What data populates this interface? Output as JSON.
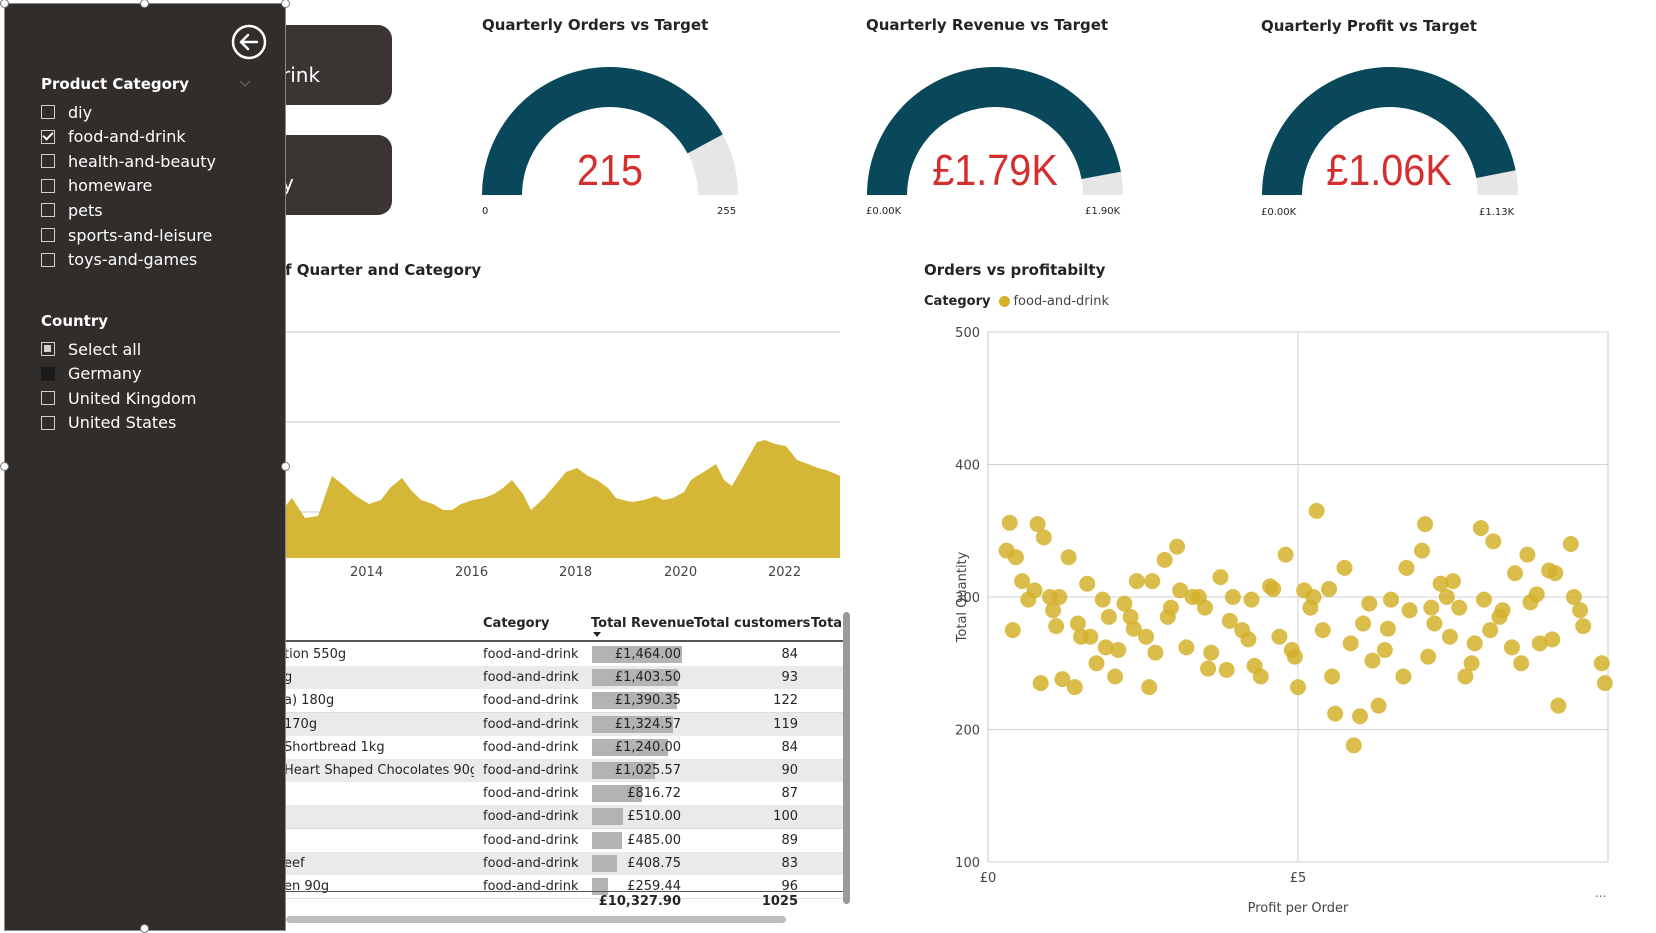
{
  "nav_buttons": [
    {
      "label": "rink"
    },
    {
      "label": "y"
    }
  ],
  "gauges": [
    {
      "title": "Quarterly Orders vs Target",
      "value_label": "215",
      "fraction": 0.843,
      "min_label": "0",
      "max_label": "255"
    },
    {
      "title": "Quarterly Revenue vs Target",
      "value_label": "£1.79K",
      "fraction": 0.942,
      "min_label": "£0.00K",
      "max_label": "£1.90K"
    },
    {
      "title": "Quarterly Profit vs Target",
      "value_label": "£1.06K",
      "fraction": 0.938,
      "min_label": "£0.00K",
      "max_label": "£1.13K"
    }
  ],
  "colors": {
    "gauge_fill": "#08485a",
    "gauge_track": "#e6e6e6",
    "value_red": "#d32f2f",
    "accent_gold": "#d4b22c",
    "panel_bg": "#302d2b"
  },
  "area_chart": {
    "title": "f Quarter and Category",
    "x_ticks": [
      "2014",
      "2016",
      "2018",
      "2020",
      "2022"
    ]
  },
  "chart_data": {
    "type": "scatter",
    "title": "Orders vs profitabilty",
    "legend_title": "Category",
    "series": [
      {
        "name": "food-and-drink",
        "color": "#d4b22c"
      }
    ],
    "xlabel": "Profit per Order",
    "ylabel": "Total Quantity",
    "x_tick_labels": [
      "£0",
      "£5"
    ],
    "y_tick_labels": [
      "100",
      "200",
      "300",
      "400",
      "500"
    ],
    "xlim": [
      0,
      10
    ],
    "ylim": [
      100,
      500
    ],
    "grid": true,
    "points": [
      [
        0.4,
        275
      ],
      [
        0.85,
        235
      ],
      [
        1.1,
        278
      ],
      [
        1.4,
        232
      ],
      [
        1.65,
        270
      ],
      [
        1.9,
        262
      ],
      [
        2.2,
        295
      ],
      [
        2.55,
        270
      ],
      [
        2.85,
        328
      ],
      [
        3.1,
        305
      ],
      [
        3.5,
        292
      ],
      [
        3.85,
        245
      ],
      [
        4.2,
        268
      ],
      [
        4.55,
        308
      ],
      [
        4.95,
        255
      ],
      [
        5.3,
        365
      ],
      [
        5.55,
        240
      ],
      [
        6.0,
        210
      ],
      [
        6.3,
        218
      ],
      [
        7.1,
        255
      ],
      [
        7.2,
        280
      ],
      [
        7.5,
        312
      ],
      [
        7.85,
        265
      ],
      [
        8.1,
        275
      ],
      [
        8.5,
        318
      ],
      [
        8.9,
        265
      ],
      [
        9.2,
        218
      ],
      [
        9.55,
        290
      ],
      [
        9.9,
        250
      ],
      [
        9.95,
        235
      ],
      [
        0.3,
        335
      ],
      [
        0.55,
        312
      ],
      [
        0.8,
        355
      ],
      [
        1.05,
        290
      ],
      [
        1.3,
        330
      ],
      [
        1.6,
        310
      ],
      [
        1.95,
        285
      ],
      [
        2.3,
        285
      ],
      [
        2.6,
        232
      ],
      [
        2.9,
        285
      ],
      [
        3.3,
        300
      ],
      [
        3.6,
        258
      ],
      [
        3.95,
        300
      ],
      [
        4.3,
        248
      ],
      [
        4.7,
        270
      ],
      [
        5.0,
        232
      ],
      [
        5.25,
        300
      ],
      [
        5.6,
        212
      ],
      [
        5.9,
        188
      ],
      [
        6.2,
        252
      ],
      [
        6.5,
        298
      ],
      [
        6.8,
        290
      ],
      [
        7.05,
        355
      ],
      [
        7.4,
        300
      ],
      [
        7.7,
        240
      ],
      [
        8.0,
        298
      ],
      [
        8.3,
        290
      ],
      [
        8.7,
        332
      ],
      [
        9.05,
        320
      ],
      [
        9.4,
        340
      ],
      [
        0.45,
        330
      ],
      [
        0.75,
        305
      ],
      [
        1.0,
        300
      ],
      [
        1.2,
        238
      ],
      [
        1.5,
        270
      ],
      [
        1.85,
        298
      ],
      [
        2.1,
        260
      ],
      [
        2.4,
        312
      ],
      [
        2.7,
        258
      ],
      [
        3.05,
        338
      ],
      [
        3.4,
        300
      ],
      [
        3.75,
        315
      ],
      [
        4.1,
        275
      ],
      [
        4.4,
        240
      ],
      [
        4.8,
        332
      ],
      [
        5.1,
        305
      ],
      [
        5.4,
        275
      ],
      [
        5.75,
        322
      ],
      [
        6.05,
        280
      ],
      [
        6.4,
        260
      ],
      [
        6.7,
        240
      ],
      [
        7.0,
        335
      ],
      [
        7.3,
        310
      ],
      [
        7.6,
        292
      ],
      [
        7.95,
        352
      ],
      [
        8.25,
        285
      ],
      [
        8.6,
        250
      ],
      [
        8.85,
        302
      ],
      [
        9.15,
        318
      ],
      [
        9.6,
        278
      ],
      [
        0.35,
        356
      ],
      [
        0.65,
        298
      ],
      [
        0.9,
        345
      ],
      [
        1.15,
        300
      ],
      [
        1.45,
        280
      ],
      [
        1.75,
        250
      ],
      [
        2.05,
        240
      ],
      [
        2.35,
        276
      ],
      [
        2.65,
        312
      ],
      [
        2.95,
        292
      ],
      [
        3.2,
        262
      ],
      [
        3.55,
        246
      ],
      [
        3.9,
        282
      ],
      [
        4.25,
        298
      ],
      [
        4.6,
        306
      ],
      [
        4.9,
        260
      ],
      [
        5.2,
        292
      ],
      [
        5.5,
        306
      ],
      [
        5.85,
        265
      ],
      [
        6.15,
        295
      ],
      [
        6.45,
        276
      ],
      [
        6.75,
        322
      ],
      [
        7.15,
        292
      ],
      [
        7.45,
        270
      ],
      [
        7.8,
        250
      ],
      [
        8.15,
        342
      ],
      [
        8.45,
        262
      ],
      [
        8.75,
        296
      ],
      [
        9.1,
        268
      ],
      [
        9.45,
        300
      ]
    ]
  },
  "slicers": {
    "product_category": {
      "title": "Product Category",
      "items": [
        {
          "label": "diy",
          "checked": false
        },
        {
          "label": "food-and-drink",
          "checked": true
        },
        {
          "label": "health-and-beauty",
          "checked": false
        },
        {
          "label": "homeware",
          "checked": false
        },
        {
          "label": "pets",
          "checked": false
        },
        {
          "label": "sports-and-leisure",
          "checked": false
        },
        {
          "label": "toys-and-games",
          "checked": false
        }
      ]
    },
    "country": {
      "title": "Country",
      "items": [
        {
          "label": "Select all",
          "state": "partial"
        },
        {
          "label": "Germany",
          "state": "filled"
        },
        {
          "label": "United Kingdom",
          "state": "unchecked"
        },
        {
          "label": "United States",
          "state": "unchecked"
        }
      ]
    }
  },
  "table": {
    "headers": [
      "Category",
      "Total Revenue",
      "Total customers",
      "Tota"
    ],
    "rows": [
      {
        "product": "tion 550g",
        "category": "food-and-drink",
        "revenue": "£1,464.00",
        "revenue_value": 1464.0,
        "customers": "84"
      },
      {
        "product": "g",
        "category": "food-and-drink",
        "revenue": "£1,403.50",
        "revenue_value": 1403.5,
        "customers": "93"
      },
      {
        "product": "a) 180g",
        "category": "food-and-drink",
        "revenue": "£1,390.35",
        "revenue_value": 1390.35,
        "customers": "122"
      },
      {
        "product": "170g",
        "category": "food-and-drink",
        "revenue": "£1,324.57",
        "revenue_value": 1324.57,
        "customers": "119"
      },
      {
        "product": "Shortbread 1kg",
        "category": "food-and-drink",
        "revenue": "£1,240.00",
        "revenue_value": 1240.0,
        "customers": "84"
      },
      {
        "product": "Heart Shaped Chocolates 90g",
        "category": "food-and-drink",
        "revenue": "£1,025.57",
        "revenue_value": 1025.57,
        "customers": "90"
      },
      {
        "product": "",
        "category": "food-and-drink",
        "revenue": "£816.72",
        "revenue_value": 816.72,
        "customers": "87"
      },
      {
        "product": "",
        "category": "food-and-drink",
        "revenue": "£510.00",
        "revenue_value": 510.0,
        "customers": "100"
      },
      {
        "product": "",
        "category": "food-and-drink",
        "revenue": "£485.00",
        "revenue_value": 485.0,
        "customers": "89"
      },
      {
        "product": "eef",
        "category": "food-and-drink",
        "revenue": "£408.75",
        "revenue_value": 408.75,
        "customers": "83"
      },
      {
        "product": "en 90g",
        "category": "food-and-drink",
        "revenue": "£259.44",
        "revenue_value": 259.44,
        "customers": "96"
      }
    ],
    "totals": {
      "revenue": "£10,327.90",
      "customers": "1025"
    }
  },
  "overflow_glyph": "..."
}
